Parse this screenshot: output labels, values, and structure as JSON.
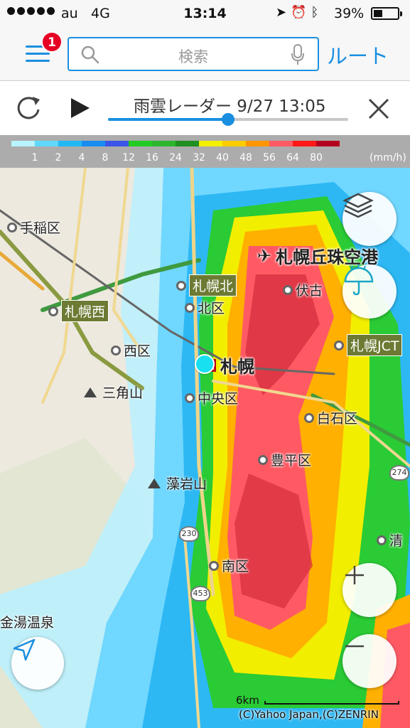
{
  "status_bar": {
    "carrier": "au",
    "network": "4G",
    "time": "13:14",
    "battery": "39%",
    "battery_level": 0.39,
    "icons": [
      "location-arrow-icon",
      "alarm-icon",
      "bluetooth-icon"
    ]
  },
  "search_bar": {
    "menu_badge": "1",
    "placeholder": "検索",
    "route_label": "ルート"
  },
  "radar_bar": {
    "title": "雨雲レーダー 9/27 13:05",
    "progress": 0.5
  },
  "legend": {
    "colors": [
      "#b8f4ff",
      "#5fd7ff",
      "#22b8f4",
      "#1a8cf0",
      "#3a55e8",
      "#22cc22",
      "#2db52d",
      "#1f8f1f",
      "#f3f000",
      "#ffcc00",
      "#ff9500",
      "#ff5a64",
      "#ff1818",
      "#b4001e"
    ],
    "labels": [
      "1",
      "2",
      "4",
      "8",
      "12",
      "16",
      "24",
      "32",
      "40",
      "48",
      "56",
      "64",
      "80"
    ],
    "unit": "(mm/h)"
  },
  "map": {
    "places": [
      {
        "id": "teine",
        "label": "手稲区"
      },
      {
        "id": "kita-ku",
        "label": "北区"
      },
      {
        "id": "nishi-ku",
        "label": "西区"
      },
      {
        "id": "chuo-ku",
        "label": "中央区"
      },
      {
        "id": "fushiko",
        "label": "伏古"
      },
      {
        "id": "shiroishi",
        "label": "白石区"
      },
      {
        "id": "toyohira",
        "label": "豊平区"
      },
      {
        "id": "minami-ku",
        "label": "南区"
      },
      {
        "id": "kiyota",
        "label": "清"
      },
      {
        "id": "kinyu",
        "label": "金湯温泉"
      }
    ],
    "stations": [
      {
        "id": "sapporo-kita",
        "label": "札幌北"
      },
      {
        "id": "sapporo-nishi",
        "label": "札幌西"
      },
      {
        "id": "sapporo-jct",
        "label": "札幌JCT"
      }
    ],
    "city_label": "札幌",
    "airport_label": "札幌丘珠空港",
    "mountains": [
      "三角山",
      "藻岩山"
    ],
    "route_shields": [
      "274",
      "230",
      "453"
    ],
    "scale_label": "6km",
    "copyright": "(C)Yahoo Japan,(C)ZENRIN"
  },
  "accent_color": "#1a8fe0"
}
